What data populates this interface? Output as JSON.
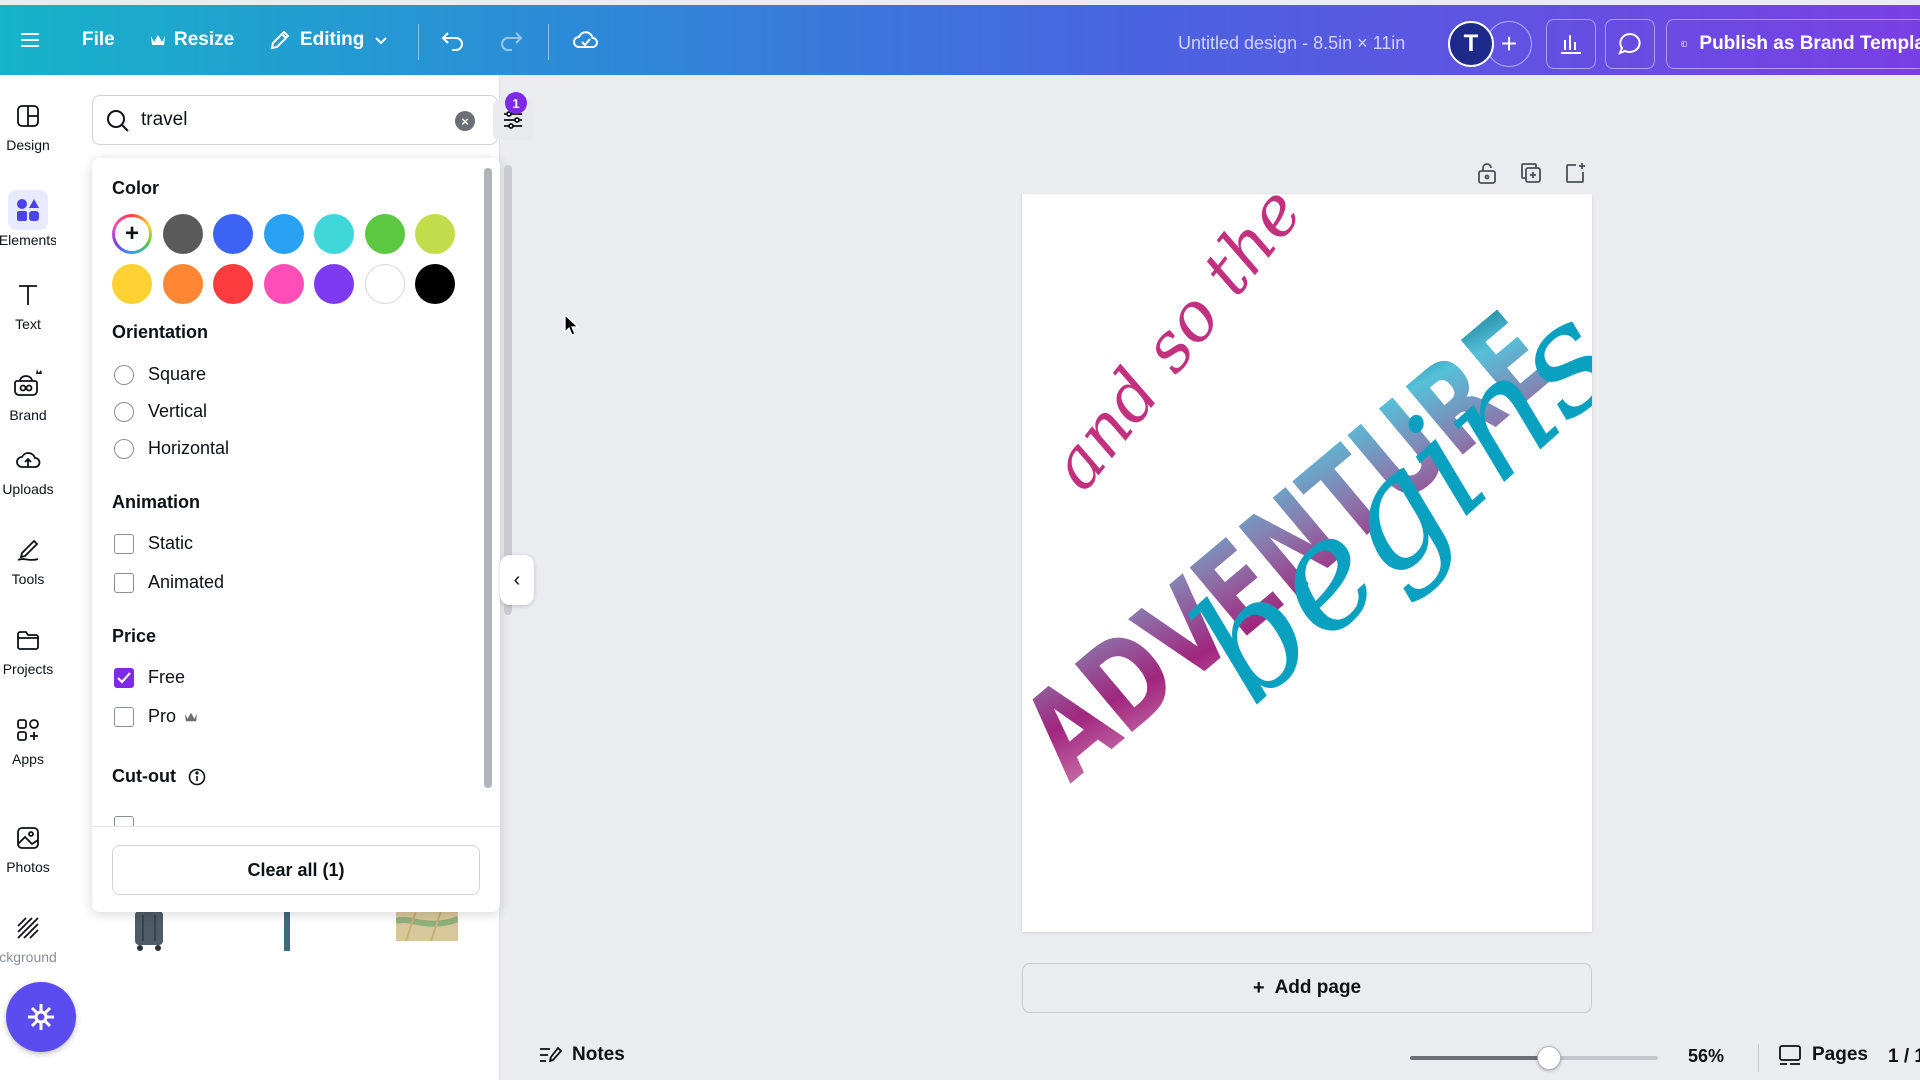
{
  "topbar": {
    "file_label": "File",
    "resize_label": "Resize",
    "editing_label": "Editing",
    "doc_title": "Untitled design - 8.5in × 11in",
    "avatar_initial": "T",
    "publish_label": "Publish as Brand Templa"
  },
  "rail": {
    "items": [
      {
        "label": "Design",
        "icon": "design-icon"
      },
      {
        "label": "Elements",
        "icon": "elements-icon"
      },
      {
        "label": "Text",
        "icon": "text-icon"
      },
      {
        "label": "Brand",
        "icon": "brand-icon"
      },
      {
        "label": "Uploads",
        "icon": "upload-cloud-icon"
      },
      {
        "label": "Tools",
        "icon": "draw-icon"
      },
      {
        "label": "Projects",
        "icon": "folder-icon"
      },
      {
        "label": "Apps",
        "icon": "apps-icon"
      },
      {
        "label": "Photos",
        "icon": "photo-icon"
      },
      {
        "label": "ckground",
        "icon": "background-icon"
      }
    ]
  },
  "search": {
    "value": "travel",
    "filter_count": "1"
  },
  "filters": {
    "color": {
      "title": "Color",
      "swatches": [
        "#5a5a5a",
        "#3d63f5",
        "#2aa1f2",
        "#3fd7d9",
        "#5cc842",
        "#c2dc4b",
        "#ffd234",
        "#ff8733",
        "#fb3b3e",
        "#ff4eb6",
        "#7d3af0",
        "#ffffff",
        "#000000"
      ]
    },
    "orientation": {
      "title": "Orientation",
      "options": [
        "Square",
        "Vertical",
        "Horizontal"
      ]
    },
    "animation": {
      "title": "Animation",
      "options": [
        "Static",
        "Animated"
      ]
    },
    "price": {
      "title": "Price",
      "options": [
        {
          "label": "Free",
          "checked": true
        },
        {
          "label": "Pro",
          "checked": false
        }
      ]
    },
    "cutout": {
      "title": "Cut-out"
    },
    "clear_label": "Clear all (1)"
  },
  "canvas": {
    "text_line1": "and so the",
    "text_line2": "ADVENTURE",
    "text_line3": "begins",
    "add_page_label": "Add page"
  },
  "bottombar": {
    "notes_label": "Notes",
    "zoom": "56%",
    "zoom_fraction": 0.56,
    "pages_label": "Pages",
    "page_count": "1 / 1"
  },
  "colors": {
    "accent": "#7d2ae8",
    "magenta": "#c2317e",
    "teal": "#0aa0bf"
  }
}
